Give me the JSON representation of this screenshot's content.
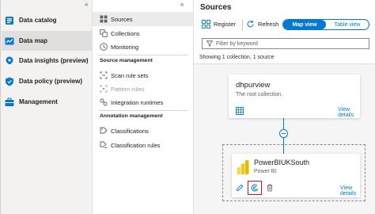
{
  "left_nav": {
    "collapse_glyph": "«",
    "items": [
      {
        "label": "Data catalog",
        "icon": "data-catalog-icon",
        "active": false
      },
      {
        "label": "Data map",
        "icon": "data-map-icon",
        "active": true
      },
      {
        "label": "Data insights (preview)",
        "icon": "data-insights-icon",
        "active": false
      },
      {
        "label": "Data policy (preview)",
        "icon": "data-policy-icon",
        "active": false
      },
      {
        "label": "Management",
        "icon": "management-icon",
        "active": false
      }
    ]
  },
  "sub_nav": {
    "collapse_glyph": "«",
    "items": [
      {
        "label": "Sources",
        "icon": "sources-grid-icon",
        "active": true
      },
      {
        "label": "Collections",
        "icon": "collections-icon"
      },
      {
        "label": "Monitoring",
        "icon": "monitoring-icon"
      }
    ],
    "source_management": {
      "title": "Source management",
      "items": [
        {
          "label": "Scan rule sets",
          "icon": "scan-rule-sets-icon",
          "disabled": false
        },
        {
          "label": "Pattern rules",
          "icon": "pattern-rules-icon",
          "disabled": true
        },
        {
          "label": "Integration runtimes",
          "icon": "integration-runtimes-icon",
          "disabled": false
        }
      ]
    },
    "annotation_management": {
      "title": "Annotation management",
      "items": [
        {
          "label": "Classifications",
          "icon": "classifications-icon"
        },
        {
          "label": "Classification rules",
          "icon": "classification-rules-icon"
        }
      ]
    }
  },
  "main": {
    "title": "Sources",
    "toolbar": {
      "register_label": "Register",
      "refresh_label": "Refresh",
      "map_view_label": "Map view",
      "table_view_label": "Table view",
      "active_view": "Map view"
    },
    "filter": {
      "placeholder": "Filter by keyword"
    },
    "status_text": "Showing 1 collection, 1 source",
    "collection_card": {
      "name": "dhpurview",
      "description": "The root collection.",
      "view_details_label": "View details"
    },
    "source_card": {
      "name": "PowerBIUKSouth",
      "type": "Power BI",
      "view_details_label": "View details",
      "highlighted_action": "new-scan"
    }
  },
  "colors": {
    "accent": "#0078d4",
    "highlight": "#e81123",
    "powerbi_yellow": "#f2c811",
    "nav_bg": "#f3f2f1"
  }
}
